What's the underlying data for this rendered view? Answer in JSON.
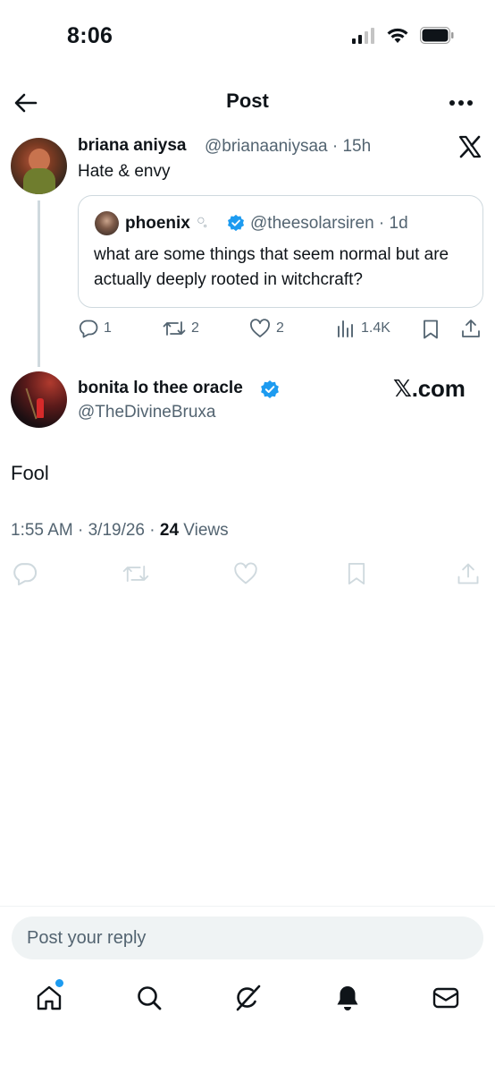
{
  "status_bar": {
    "time": "8:06"
  },
  "header": {
    "title": "Post"
  },
  "parent_post": {
    "author_name": "briana aniysa",
    "handle_time": "@brianaaniysaa · 15h",
    "text": "Hate & envy",
    "quote": {
      "author_name": "phoenix",
      "emoji": "○̥",
      "handle_time": "@theesolarsiren · 1d",
      "text": "what are some things that seem normal but are actually deeply rooted in witchcraft?"
    },
    "stats": {
      "replies": "1",
      "reposts": "2",
      "likes": "2",
      "views": "1.4K"
    }
  },
  "main_post": {
    "author_name": "bonita lo thee oracle",
    "handle": "@TheDivineBruxa",
    "watermark": "𝕏.com",
    "text": "Fool",
    "meta_prefix": "1:55 AM · 3/19/26 · ",
    "views_count": "24",
    "views_label": " Views"
  },
  "reply_bar": {
    "placeholder": "Post your reply"
  },
  "colors": {
    "accent": "#1d9bf0",
    "text": "#0f1419",
    "secondary": "#536471",
    "border": "#cfd9de"
  },
  "icons": [
    "back-arrow-icon",
    "more-icon",
    "x-logo-icon",
    "verified-icon",
    "reply-icon",
    "repost-icon",
    "like-icon",
    "views-icon",
    "bookmark-icon",
    "share-icon",
    "home-icon",
    "search-icon",
    "grok-icon",
    "bell-icon",
    "mail-icon"
  ]
}
